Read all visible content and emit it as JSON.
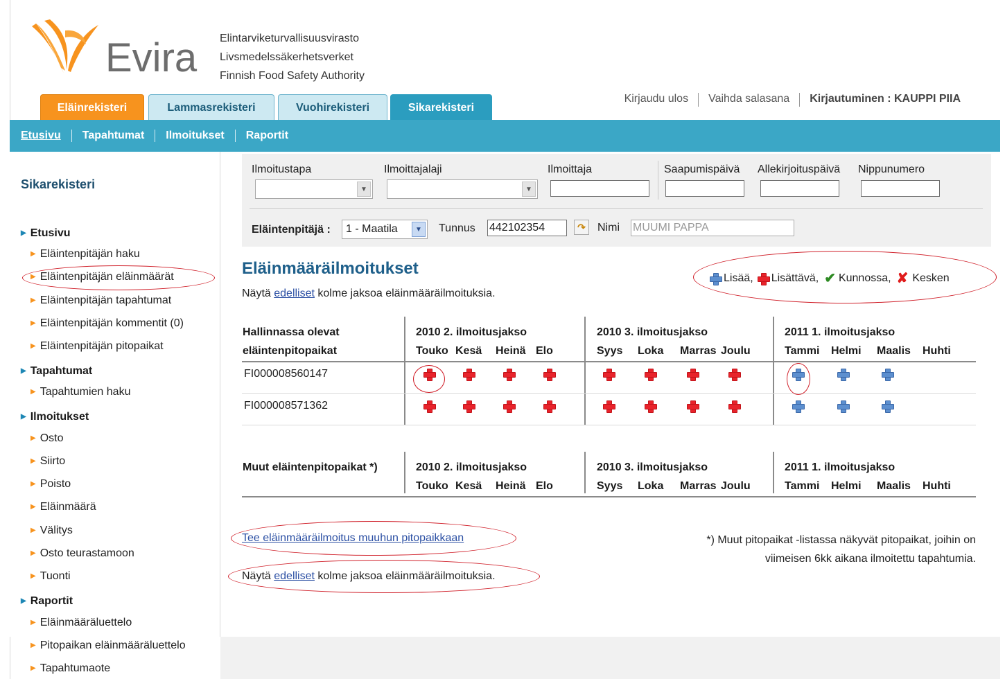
{
  "logo": {
    "word": "Evira",
    "subtitle": [
      "Elintarviketurvallisuusvirasto",
      "Livsmedelssäkerhetsverket",
      "Finnish Food Safety Authority"
    ]
  },
  "tabs": [
    "Eläinrekisteri",
    "Lammasrekisteri",
    "Vuohirekisteri",
    "Sikarekisteri"
  ],
  "topright": {
    "logout": "Kirjaudu ulos",
    "change_password": "Vaihda salasana",
    "login": "Kirjautuminen : KAUPPI PIIA"
  },
  "navbar": [
    "Etusivu",
    "Tapahtumat",
    "Ilmoitukset",
    "Raportit"
  ],
  "sidebar": {
    "title": "Sikarekisteri",
    "items": [
      {
        "label": "Etusivu",
        "level": "top"
      },
      {
        "label": "Eläintenpitäjän haku",
        "level": "sub"
      },
      {
        "label": "Eläintenpitäjän eläinmäärät",
        "level": "sub"
      },
      {
        "label": "Eläintenpitäjän tapahtumat",
        "level": "sub"
      },
      {
        "label": "Eläintenpitäjän kommentit (0)",
        "level": "sub"
      },
      {
        "label": "Eläintenpitäjän pitopaikat",
        "level": "sub"
      },
      {
        "label": "Tapahtumat",
        "level": "top"
      },
      {
        "label": "Tapahtumien haku",
        "level": "sub"
      },
      {
        "label": "Ilmoitukset",
        "level": "top"
      },
      {
        "label": "Osto",
        "level": "sub"
      },
      {
        "label": "Siirto",
        "level": "sub"
      },
      {
        "label": "Poisto",
        "level": "sub"
      },
      {
        "label": "Eläinmäärä",
        "level": "sub"
      },
      {
        "label": "Välitys",
        "level": "sub"
      },
      {
        "label": "Osto teurastamoon",
        "level": "sub"
      },
      {
        "label": "Tuonti",
        "level": "sub"
      },
      {
        "label": "Raportit",
        "level": "top"
      },
      {
        "label": "Eläinmääräluettelo",
        "level": "sub"
      },
      {
        "label": "Pitopaikan eläinmääräluettelo",
        "level": "sub"
      },
      {
        "label": "Tapahtumaote",
        "level": "sub"
      }
    ]
  },
  "filter": {
    "ilmoitustapa": "Ilmoitustapa",
    "ilmoittajalaji": "Ilmoittajalaji",
    "ilmoittaja": "Ilmoittaja",
    "saapumispaiva": "Saapumispäivä",
    "allekirjoituspaiva": "Allekirjoituspäivä",
    "nippunumero": "Nippunumero",
    "elaintenpitaja_label": "Eläintenpitäjä :",
    "elaintenpitaja_value": "1 - Maatila",
    "tunnus_label": "Tunnus",
    "tunnus_value": "442102354",
    "nimi_label": "Nimi",
    "nimi_value": "MUUMI PAPPA"
  },
  "main": {
    "title": "Eläinmääräilmoitukset",
    "show_prev_pre": "Näytä",
    "show_prev_link": "edelliset",
    "show_prev_post": "kolme jaksoa eläinmääräilmoituksia.",
    "legend": {
      "add": "Lisää,",
      "to_add": "Lisättävä,",
      "ok": "Kunnossa,",
      "incomplete": "Kesken"
    },
    "table1": {
      "head1": "Hallinnassa olevat",
      "head2": "eläintenpitopaikat",
      "periods": [
        "2010 2. ilmoitusjakso",
        "2010 3. ilmoitusjakso",
        "2011 1. ilmoitusjakso"
      ],
      "months": [
        "Touko",
        "Kesä",
        "Heinä",
        "Elo",
        "Syys",
        "Loka",
        "Marras",
        "Joulu",
        "Tammi",
        "Helmi",
        "Maalis",
        "Huhti"
      ],
      "rows": [
        "FI000008560147",
        "FI000008571362"
      ]
    },
    "table2": {
      "head": "Muut eläintenpitopaikat *)",
      "periods": [
        "2010 2. ilmoitusjakso",
        "2010 3. ilmoitusjakso",
        "2011 1. ilmoitusjakso"
      ],
      "months": [
        "Touko",
        "Kesä",
        "Heinä",
        "Elo",
        "Syys",
        "Loka",
        "Marras",
        "Joulu",
        "Tammi",
        "Helmi",
        "Maalis",
        "Huhti"
      ]
    },
    "other_link": "Tee eläinmääräilmoitus muuhun pitopaikkaan",
    "note_line1": "*) Muut pitopaikat -listassa näkyvät pitopaikat, joihin on",
    "note_line2": "viimeisen 6kk aikana ilmoitettu tapahtumia."
  }
}
